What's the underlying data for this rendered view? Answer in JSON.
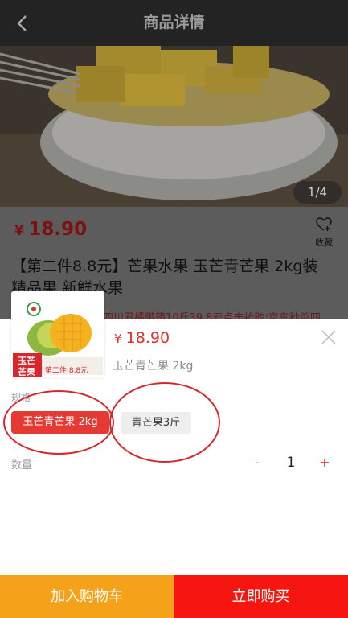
{
  "header": {
    "title": "商品详情",
    "back_icon": "chevron-left-icon"
  },
  "gallery": {
    "indicator": "1/4"
  },
  "product": {
    "currency": "¥",
    "price": "18.90",
    "favorite_label": "收藏",
    "favorite_icon": "heart-plus-icon",
    "title": "【第二件8.8元】芒果水果 玉芒青芒果 2kg装 精品果 新鲜水果",
    "promo": "四川丑橘带箱10斤39.8元点击抢购;京东秒杀四"
  },
  "sku_sheet": {
    "currency": "¥",
    "price": "18.90",
    "selected_spec": "玉芒青芒果 2kg",
    "close_icon": "close-icon",
    "thumbnail": {
      "badge_line1": "玉芒",
      "badge_line2": "芒果",
      "banner": "第二件 8.8元"
    },
    "spec_label": "规格",
    "spec_options": [
      "玉芒青芒果 2kg",
      "青芒果3斤"
    ],
    "quantity_label": "数量",
    "quantity": "1",
    "minus": "-",
    "plus": "+"
  },
  "actions": {
    "add_to_cart": "加入购物车",
    "buy_now": "立即购买"
  },
  "colors": {
    "accent": "#e43a33",
    "cart": "#f5a21b",
    "buy": "#f5170f",
    "header": "#232323"
  }
}
